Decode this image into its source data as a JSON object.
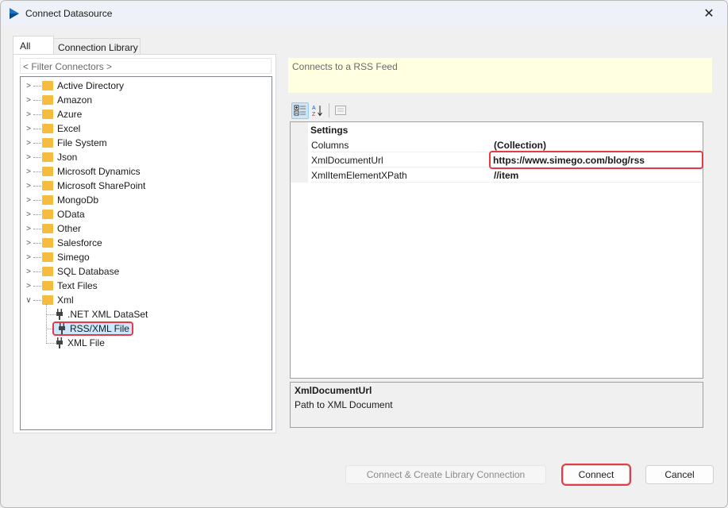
{
  "window": {
    "title": "Connect Datasource",
    "close_icon": "close-icon"
  },
  "tabs": [
    {
      "label": "All",
      "active": true
    },
    {
      "label": "Connection Library",
      "active": false
    }
  ],
  "filter": {
    "placeholder": "< Filter Connectors >"
  },
  "tree": {
    "folders": [
      "Active Directory",
      "Amazon",
      "Azure",
      "Excel",
      "File System",
      "Json",
      "Microsoft Dynamics",
      "Microsoft SharePoint",
      "MongoDb",
      "OData",
      "Other",
      "Salesforce",
      "Simego",
      "SQL Database",
      "Text Files",
      "Xml"
    ],
    "expanded": "Xml",
    "children": [
      {
        "label": ".NET XML DataSet",
        "selected": false
      },
      {
        "label": "RSS/XML File",
        "selected": true
      },
      {
        "label": "XML File",
        "selected": false
      }
    ]
  },
  "description": "Connects to a RSS Feed",
  "toolbar": {
    "categorized_icon": "categorized-icon",
    "alphabetical_icon": "sort-az-icon",
    "property_pages_icon": "property-pages-icon"
  },
  "properties": {
    "category": "Settings",
    "rows": [
      {
        "name": "Columns",
        "value": "(Collection)"
      },
      {
        "name": "XmlDocumentUrl",
        "value": "https://www.simego.com/blog/rss",
        "highlighted": true
      },
      {
        "name": "XmlItemElementXPath",
        "value": "//item"
      }
    ]
  },
  "help": {
    "title": "XmlDocumentUrl",
    "text": "Path to XML Document"
  },
  "buttons": {
    "connect_create": "Connect & Create Library Connection",
    "connect": "Connect",
    "cancel": "Cancel"
  },
  "colors": {
    "highlight": "#e43b45",
    "selection": "#cce8ff",
    "folder": "#f6bc3f",
    "description_bg": "#ffffe1"
  }
}
